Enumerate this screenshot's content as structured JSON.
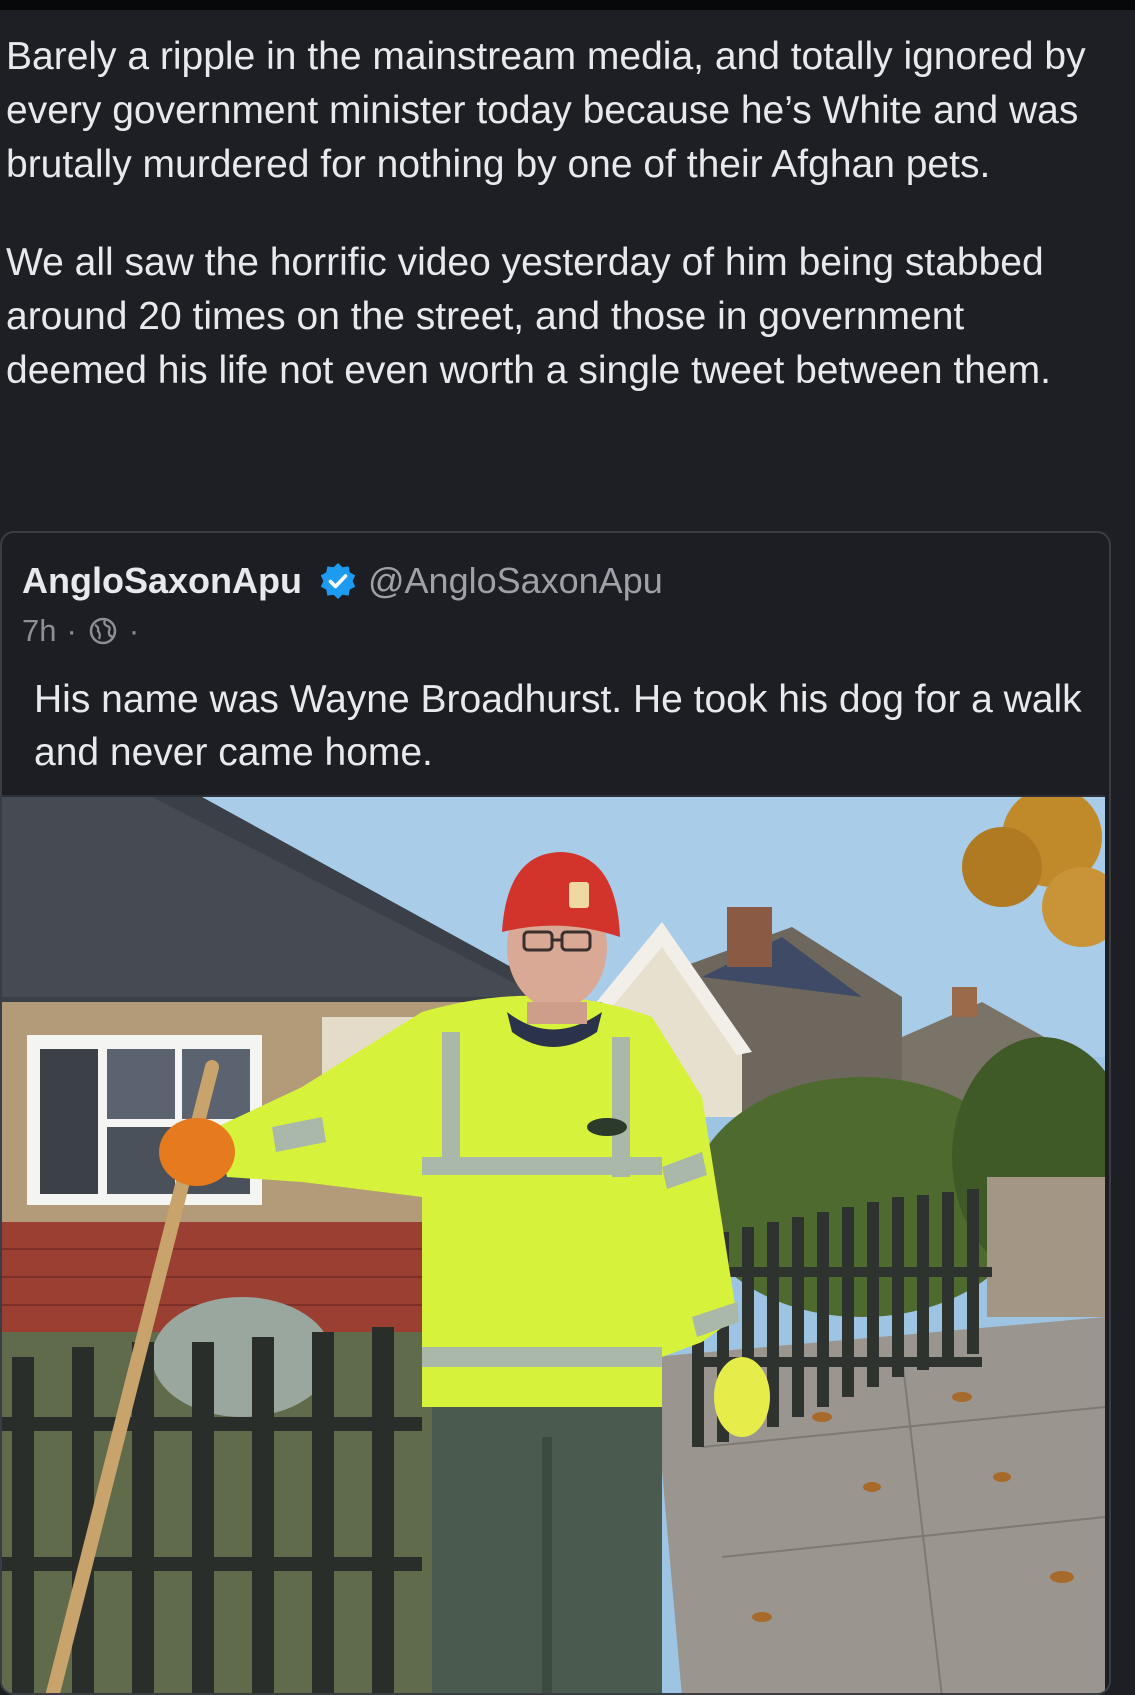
{
  "post": {
    "paragraphs": [
      "Barely a ripple in the mainstream media, and totally ignored by every government minister today because he’s White and was brutally murdered for nothing by one of their Afghan pets.",
      "We all saw the horrific video yesterday of him being stabbed around 20 times on the street, and those in government deemed his life not even worth a single tweet between them."
    ]
  },
  "quoted": {
    "author": "AngloSaxonApu",
    "handle": "@AngloSaxonApu",
    "time": "7h",
    "separator": "·",
    "text": "His name was Wayne Broadhurst. He took his dog for a walk and never came home.",
    "icons": {
      "verified": "verified-badge-icon",
      "audience": "globe-icon"
    },
    "colors": {
      "verified": "#1d9bf0",
      "background": "#1c1e23"
    }
  }
}
